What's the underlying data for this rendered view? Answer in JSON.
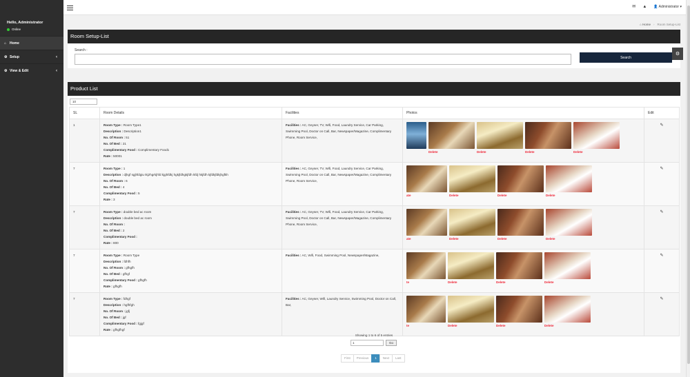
{
  "sidebar": {
    "greeting": "Hello, Administrator",
    "status": "Online",
    "items": [
      {
        "label": "Home",
        "icon": "home-icon"
      },
      {
        "label": "Setup",
        "icon": "gears-icon"
      },
      {
        "label": "View & Edit",
        "icon": "gears-icon"
      }
    ]
  },
  "header": {
    "user": "Administrator"
  },
  "breadcrumb": {
    "home": "Home",
    "current": "Room Setup-List"
  },
  "search_panel": {
    "title": "Room Setup-List",
    "label": "Search :",
    "button": "Search"
  },
  "list_panel": {
    "title": "Product List",
    "page_length": "10",
    "columns": [
      "SL",
      "Room Details",
      "Facilities",
      "Photos",
      "Edit"
    ],
    "rows": [
      {
        "sl": "1",
        "room_type": "Room Type1",
        "description": "Description1",
        "no_of_room": "51",
        "no_of_bed": "21",
        "complimentary_food": "Complimentary Food1",
        "rate": "50001",
        "facilities": "AC, Geyser, TV, Wifi, Food, Laundry Service, Car Parking, Swimming Pool, Doctor on Call, Bar, Newspaper/Magazine, Complimentary Phone, Room Service,",
        "photos": [
          {
            "del": "",
            "style": "e",
            "w": 29
          },
          {
            "del": "Delete",
            "style": "a",
            "w": 67
          },
          {
            "del": "Delete",
            "style": "b",
            "w": 67
          },
          {
            "del": "Delete",
            "style": "c",
            "w": 67
          },
          {
            "del": "Delete",
            "style": "d",
            "w": 67
          }
        ]
      },
      {
        "sl": "7",
        "room_type": "1",
        "description": "djhgf sgjhfdgiu tkjzhgrkjhfd kjghfdkj hgkjfdhgkjfdh kfdj hkjfdh kjfdkjfdkjhgfkh",
        "no_of_room": "6",
        "no_of_bed": "4",
        "complimentary_food": "5",
        "rate": "3",
        "facilities": "AC, Geyser, TV, Wifi, Food, Laundry Service, Car Parking, Swimming Pool, Doctor on Call, Bar, Newspaper/Magazine, Complimentary Phone, Room Service,",
        "photos": [
          {
            "del": "ate",
            "style": "a",
            "w": 59
          },
          {
            "del": "Delete",
            "style": "b",
            "w": 67
          },
          {
            "del": "Delete",
            "style": "c",
            "w": 67
          },
          {
            "del": "Delete",
            "style": "d",
            "w": 67
          }
        ]
      },
      {
        "sl": "7",
        "room_type": "double bed ac room",
        "description": "double bed ac room",
        "no_of_room": "",
        "no_of_bed": "2",
        "complimentary_food": "",
        "rate": "800",
        "facilities": "AC, Geyser, TV, Wifi, Food, Laundry Service, Car Parking, Swimming Pool, Doctor on Call, Bar, Newspaper/Magazine, Complimentary Phone, Room Service,",
        "photos": [
          {
            "del": "ate",
            "style": "a",
            "w": 59
          },
          {
            "del": "Delete",
            "style": "b",
            "w": 67
          },
          {
            "del": "Delete",
            "style": "c",
            "w": 67
          },
          {
            "del": "Delete",
            "style": "d",
            "w": 67
          }
        ]
      },
      {
        "sl": "7",
        "room_type": "Room Type",
        "description": "fdhfh",
        "no_of_room": "gfhgfh",
        "no_of_bed": "gfhgf",
        "complimentary_food": "gfhgfh",
        "rate": "gfhgfh",
        "facilities": "AC, Wifi, Food, Swimming Pool, Newspaper/Magazine,",
        "photos": [
          {
            "del": "te",
            "style": "a",
            "w": 57
          },
          {
            "del": "Delete",
            "style": "b",
            "w": 67
          },
          {
            "del": "Delete",
            "style": "c",
            "w": 67
          },
          {
            "del": "Delete",
            "style": "d",
            "w": 67
          }
        ]
      },
      {
        "sl": "7",
        "room_type": "fdhgf",
        "description": "hgfhfgh",
        "no_of_room": "jgfj",
        "no_of_bed": "jgf",
        "complimentary_food": "fgjgf",
        "rate": "gfhgfhgf",
        "facilities": "AC, Geyser, Wifi, Laundry Service, Swimming Pool, Doctor on Call, Bar,",
        "photos": [
          {
            "del": "te",
            "style": "a",
            "w": 57
          },
          {
            "del": "Delete",
            "style": "b",
            "w": 67
          },
          {
            "del": "Delete",
            "style": "c",
            "w": 67
          },
          {
            "del": "Delete",
            "style": "d",
            "w": 67
          }
        ]
      }
    ],
    "labels": {
      "room_type": "Room Type :",
      "description": "Description :",
      "no_of_room": "No. Of Room :",
      "no_of_bed": "No. Of Bed :",
      "complimentary_food": "Complimentary Food :",
      "rate": "Rate :",
      "facilities": "Facilities :"
    },
    "info": "Showing 1 to 6 of 5 entries",
    "goto_value": "1",
    "goto_button": "Go",
    "pager": [
      "First",
      "Previous",
      "1",
      "Next",
      "Last"
    ],
    "current_page": "1"
  }
}
